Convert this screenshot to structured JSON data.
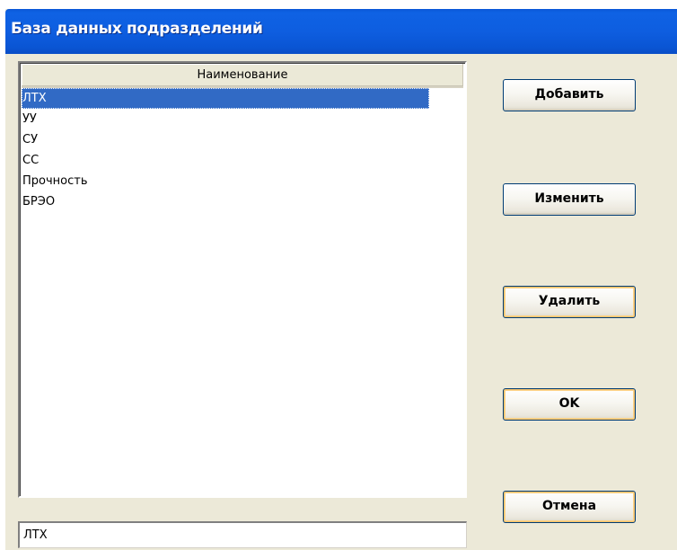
{
  "window": {
    "title": "База данных подразделений"
  },
  "list": {
    "column_header": "Наименование",
    "items": [
      {
        "label": "ЛТХ",
        "selected": true
      },
      {
        "label": "УУ",
        "selected": false
      },
      {
        "label": "СУ",
        "selected": false
      },
      {
        "label": "СС",
        "selected": false
      },
      {
        "label": "Прочность",
        "selected": false
      },
      {
        "label": "БРЭО",
        "selected": false
      }
    ]
  },
  "edit": {
    "value": "ЛТХ"
  },
  "buttons": {
    "add": "Добавить",
    "edit": "Изменить",
    "delete": "Удалить",
    "ok": "OK",
    "cancel": "Отмена"
  },
  "colors": {
    "titlebar": "#0e5ee0",
    "selection": "#316ac5",
    "window_bg": "#ece9d8"
  }
}
